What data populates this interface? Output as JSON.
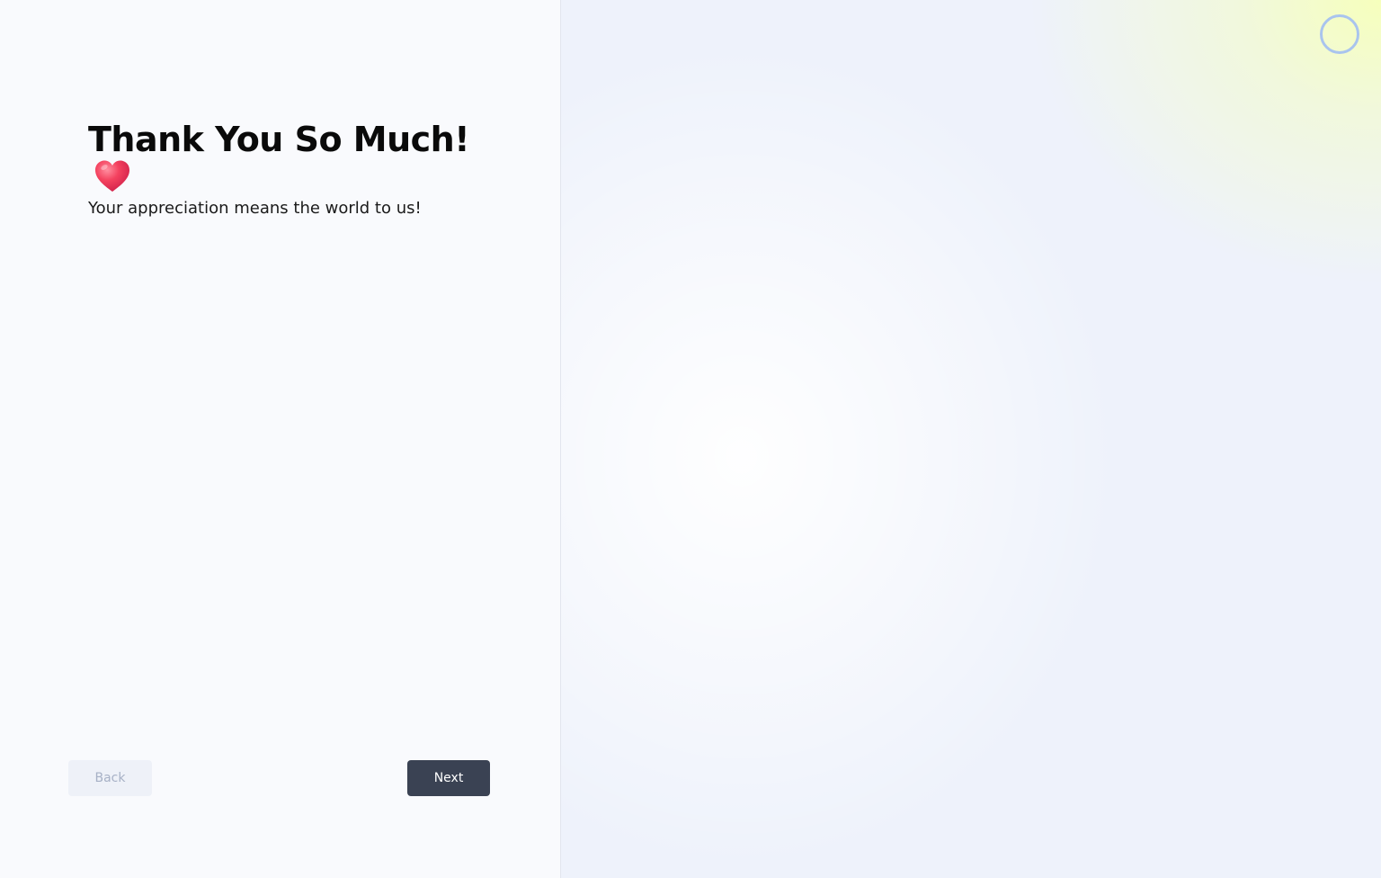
{
  "content": {
    "title": "Thank You So Much!",
    "heart_icon": "red-heart-icon",
    "subtitle": "Your appreciation means the world to us!"
  },
  "footer": {
    "back_label": "Back",
    "next_label": "Next",
    "back_disabled": true
  },
  "status": {
    "loader_icon": "loading-ring-icon"
  },
  "colors": {
    "next_button_bg": "#3a4253",
    "back_button_bg": "#eef1f8",
    "back_button_text": "#a7b1c6",
    "heart": "#f0385a",
    "loader_ring": "#a9c4ee",
    "panel_bg": "#f9fafd"
  }
}
